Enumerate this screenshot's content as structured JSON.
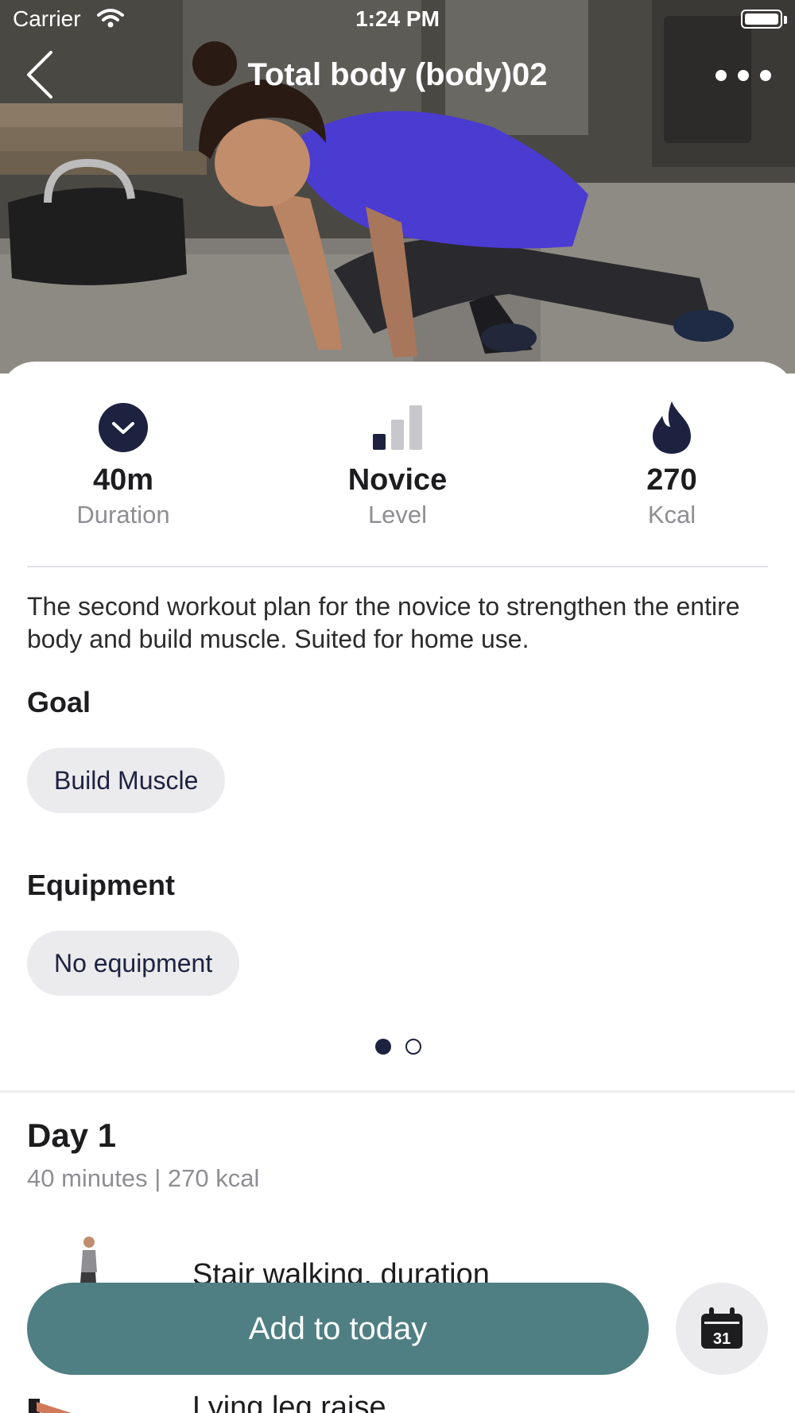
{
  "status_bar": {
    "carrier": "Carrier",
    "time": "1:24 PM"
  },
  "nav": {
    "title": "Total body (body)02",
    "back_icon": "chevron-left-icon",
    "more_icon": "ellipsis-icon"
  },
  "stats": [
    {
      "value": "40m",
      "label": "Duration",
      "icon": "clock-icon"
    },
    {
      "value": "Novice",
      "label": "Level",
      "icon": "level-bars-icon"
    },
    {
      "value": "270",
      "label": "Kcal",
      "icon": "flame-icon"
    }
  ],
  "description": "The second workout plan for the novice to strengthen the entire body and build muscle. Suited for home use.",
  "goal": {
    "title": "Goal",
    "chip": "Build Muscle"
  },
  "equipment": {
    "title": "Equipment",
    "chip": "No equipment"
  },
  "pager": {
    "pages": 2,
    "active": 1
  },
  "day": {
    "title": "Day 1",
    "meta": "40 minutes | 270 kcal",
    "exercises": [
      {
        "name": "Stair walking, duration"
      },
      {
        "name": "Lying leg raise"
      }
    ]
  },
  "actions": {
    "add_label": "Add to today",
    "calendar_day": "31"
  },
  "colors": {
    "accent": "#4f7f82",
    "navy": "#1d2240",
    "chip_bg": "#ebebed"
  }
}
